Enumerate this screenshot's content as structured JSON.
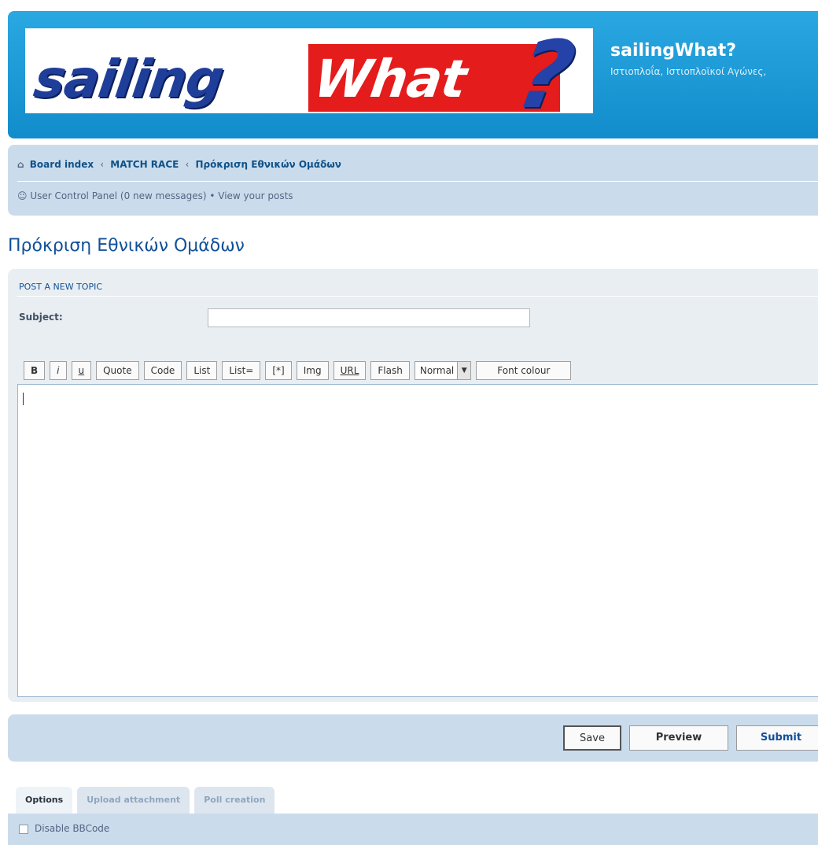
{
  "header": {
    "logo": {
      "sailing": "sailing",
      "what": "What",
      "q": "?"
    },
    "site_title": "sailingWhat?",
    "site_desc": "Ιστιοπλοΐα, Ιστιοπλοϊκοί Αγώνες,"
  },
  "nav": {
    "crumbs": [
      "Board index",
      "MATCH RACE",
      "Πρόκριση Εθνικών Ομάδων"
    ],
    "crumb_sep": "‹",
    "ucp": {
      "label": "User Control Panel",
      "messages": "(0 new messages)",
      "bullet": "•",
      "view_posts": "View your posts"
    }
  },
  "page_title": "Πρόκριση Εθνικών Ομάδων",
  "form": {
    "heading": "POST A NEW TOPIC",
    "subject_label": "Subject:",
    "subject_value": "",
    "toolbar": {
      "bold": "B",
      "italic": "i",
      "underline": "u",
      "quote": "Quote",
      "code": "Code",
      "list": "List",
      "list_ordered": "List=",
      "list_item": "[*]",
      "img": "Img",
      "url": "URL",
      "flash": "Flash",
      "font_size": "Normal",
      "font_colour": "Font colour"
    },
    "message": ""
  },
  "buttons": {
    "save": "Save",
    "preview": "Preview",
    "submit": "Submit"
  },
  "tabs": [
    "Options",
    "Upload attachment",
    "Poll creation"
  ],
  "options": {
    "disable_bbcode": "Disable BBCode"
  }
}
